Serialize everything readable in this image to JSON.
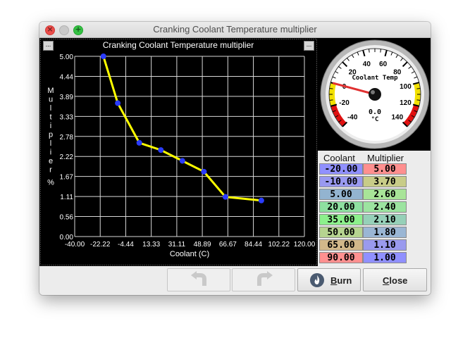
{
  "window": {
    "title": "Cranking Coolant Temperature multiplier"
  },
  "chart_data": {
    "type": "line",
    "title": "Cranking Coolant Temperature multiplier",
    "xlabel": "Coolant (C)",
    "ylabel": "Multiplier %",
    "xlim": [
      -40.0,
      120.0
    ],
    "ylim": [
      0.0,
      5.0
    ],
    "x_ticks": [
      "-40.00",
      "-22.22",
      "-4.44",
      "13.33",
      "31.11",
      "48.89",
      "66.67",
      "84.44",
      "102.22",
      "120.00"
    ],
    "y_ticks": [
      "5.00",
      "4.44",
      "3.89",
      "3.33",
      "2.78",
      "2.22",
      "1.67",
      "1.11",
      "0.56",
      "0.00"
    ],
    "x": [
      -20.0,
      -10.0,
      5.0,
      20.0,
      35.0,
      50.0,
      65.0,
      90.0
    ],
    "y": [
      5.0,
      3.7,
      2.6,
      2.4,
      2.1,
      1.8,
      1.1,
      1.0
    ],
    "grid": true,
    "line_color": "#ffff00",
    "point_color": "#2a3cff"
  },
  "gauge": {
    "title": "Coolant Temp",
    "value": "0.0",
    "units": "°C",
    "min": -40,
    "max": 140,
    "current": 0,
    "labels": [
      "-40",
      "-20",
      "0",
      "20",
      "40",
      "60",
      "80",
      "100",
      "120",
      "140"
    ]
  },
  "table": {
    "headers": [
      "Coolant",
      "Multiplier"
    ],
    "coolant": [
      "-20.00",
      "-10.00",
      "5.00",
      "20.00",
      "35.00",
      "50.00",
      "65.00",
      "90.00"
    ],
    "multiplier": [
      "5.00",
      "3.70",
      "2.60",
      "2.40",
      "2.10",
      "1.80",
      "1.10",
      "1.00"
    ],
    "coolant_colors": [
      "#9090ff",
      "#9999f0",
      "#93b4d0",
      "#8ee0a0",
      "#8cf08c",
      "#b6d490",
      "#d2b88a",
      "#ff9090"
    ],
    "multiplier_colors": [
      "#ff8f8f",
      "#c8cc88",
      "#a8e498",
      "#9ce4a0",
      "#96d0b8",
      "#9ab6d4",
      "#9a9aee",
      "#9090ff"
    ]
  },
  "buttons": {
    "undo_icon": "undo-arrow-icon",
    "redo_icon": "redo-arrow-icon",
    "burn_icon": "flame-icon",
    "burn_accel": "B",
    "burn_rest": "urn",
    "close_accel": "C",
    "close_rest": "lose"
  },
  "icons": {
    "panel_menu": "..."
  }
}
